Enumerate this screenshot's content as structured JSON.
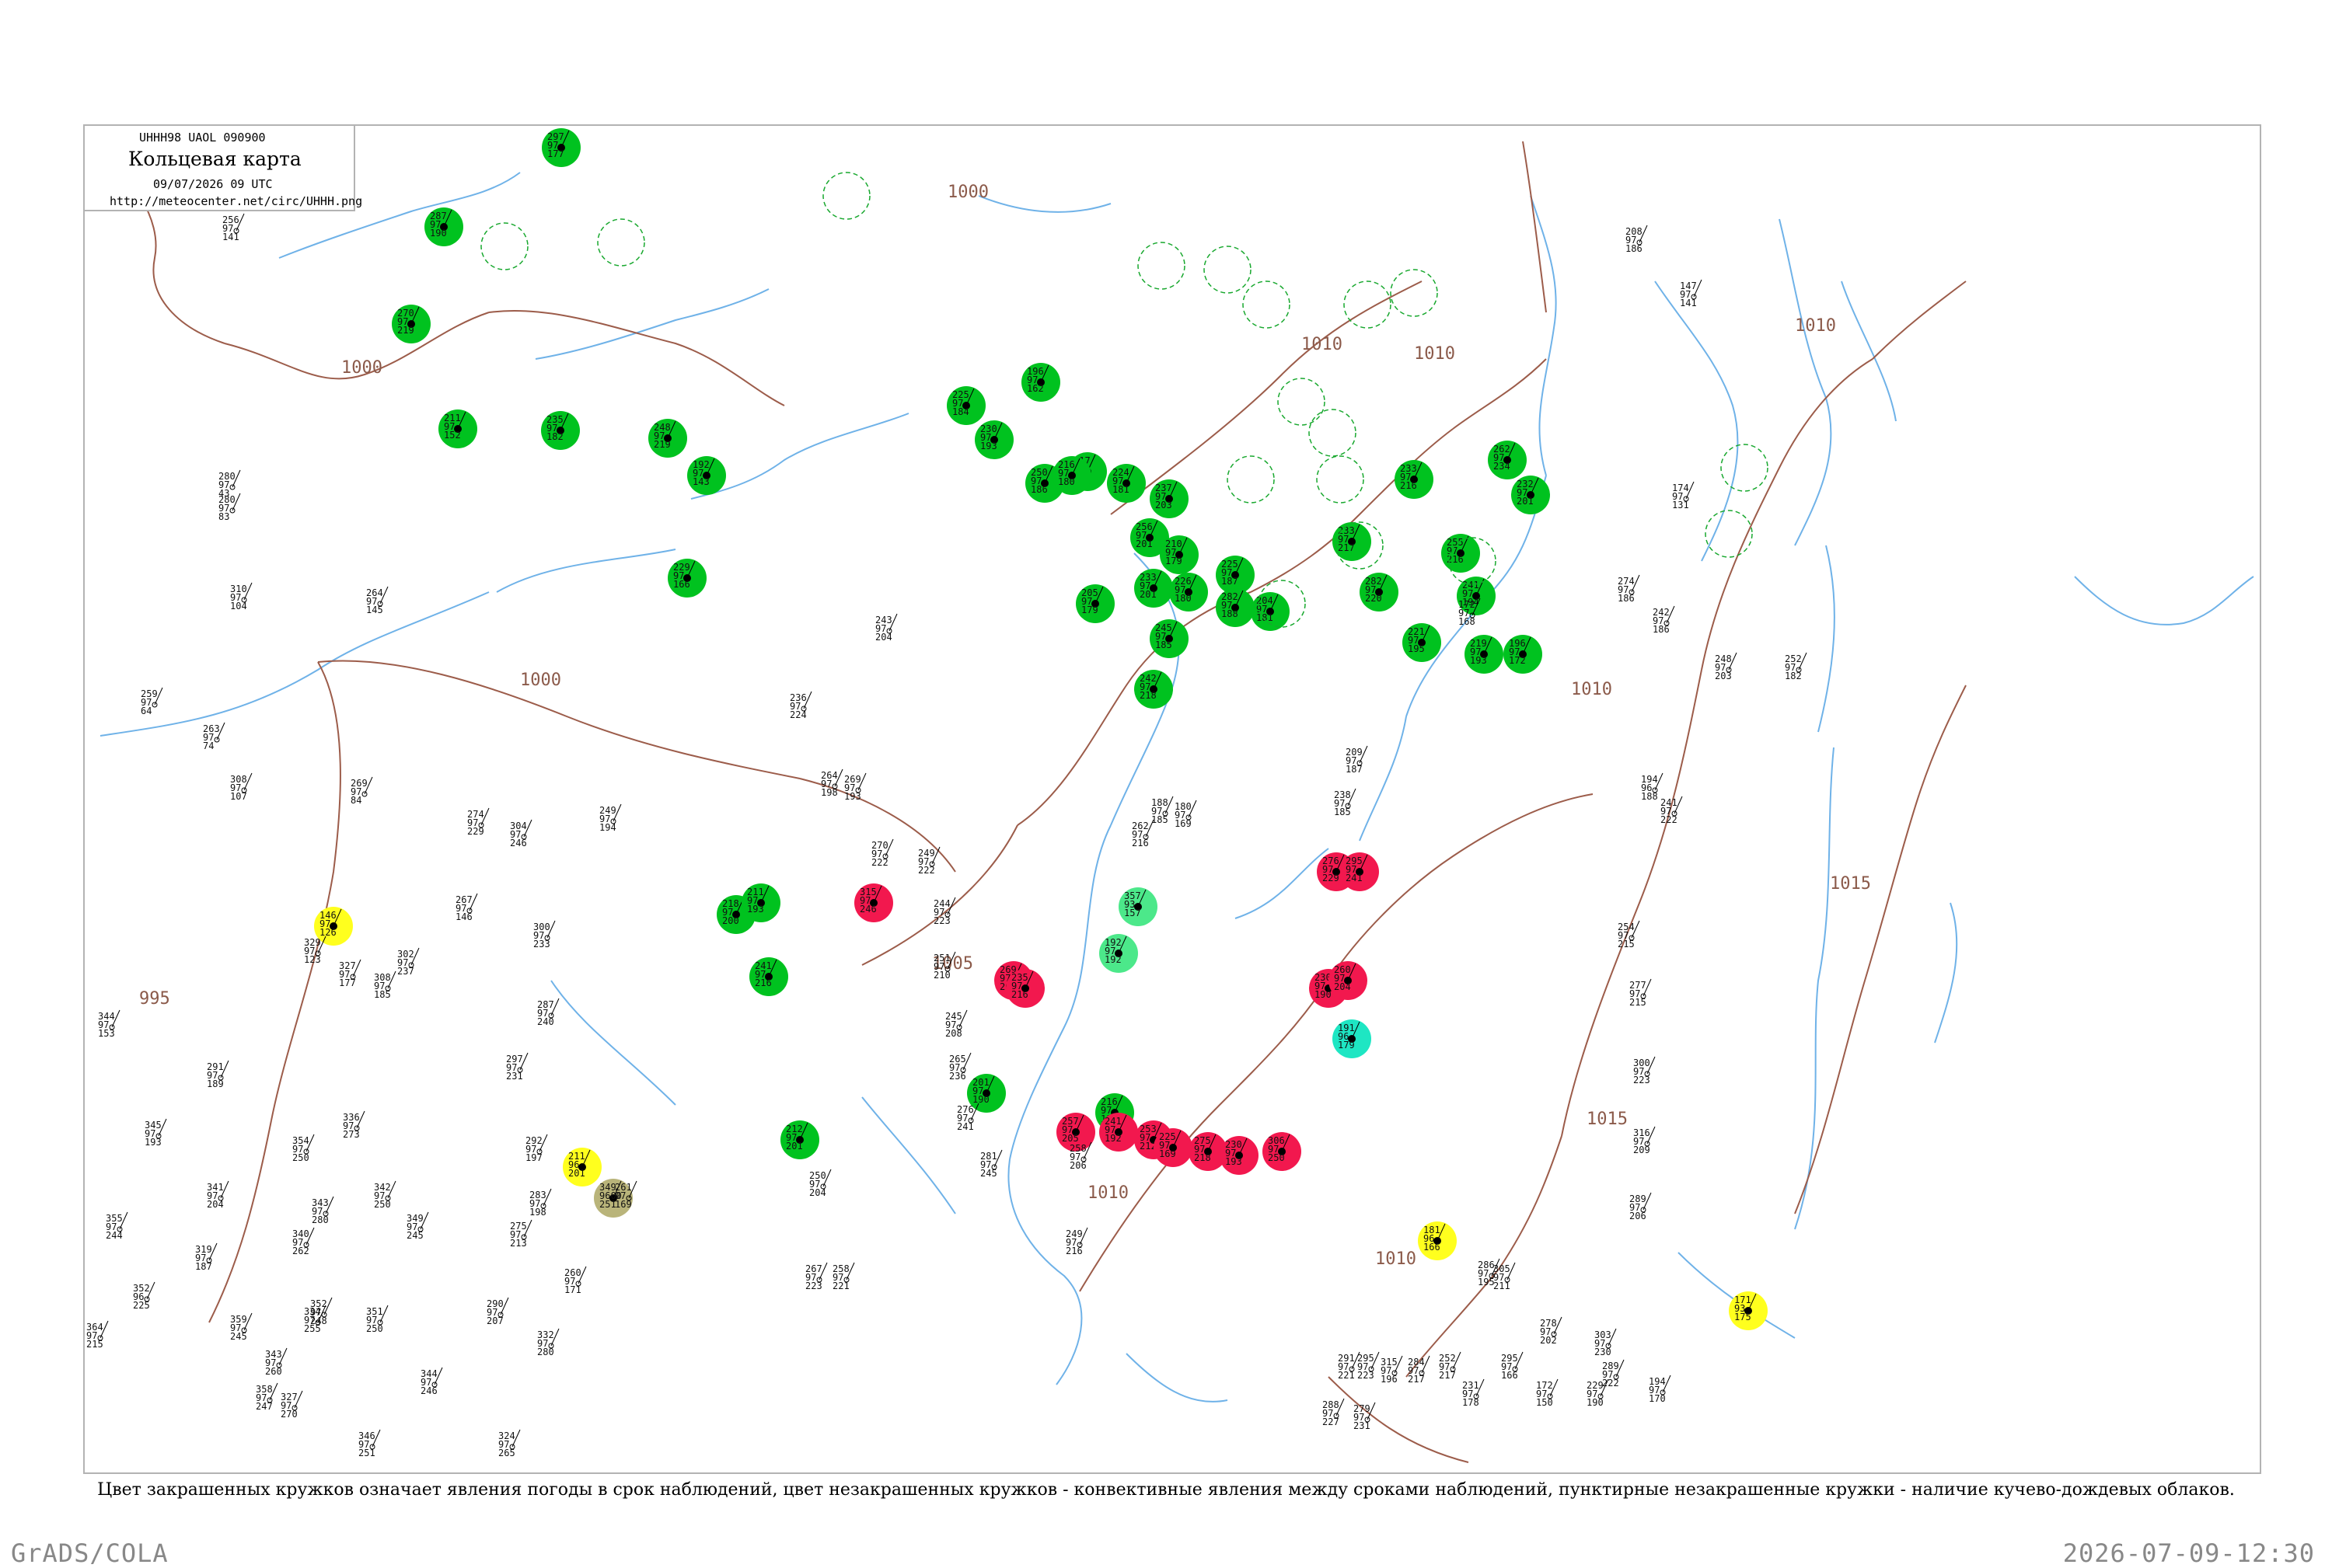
{
  "header": {
    "bulletin": "UHHH98 UAOL 090900",
    "title": "Кольцевая карта",
    "datetime": "09/07/2026 09 UTC",
    "url": "http://meteocenter.net/circ/UHHH.png"
  },
  "caption": "Цвет закрашенных кружков означает явления погоды в срок наблюдений, цвет незакрашенных кружков - конвективные явления между сроками наблюдений, пунктирные незакрашенные кружки - наличие кучево-дождевых облаков.",
  "footer": {
    "left": "GrADS/COLA",
    "right": "2026-07-09-12:30"
  },
  "colors": {
    "rain": "#00c21f",
    "thunderstorm": "#f2184e",
    "fog": "#ffff1e",
    "haze": "#1ee6c3",
    "showers": "#4ce88a",
    "dust": "#b9b47a",
    "isobar": "#9c5c4a",
    "water": "#6fb2e8",
    "cb_ring": "#18a82e"
  },
  "isobar_labels": [
    "1000",
    "1000",
    "1000",
    "995",
    "1005",
    "1010",
    "1010",
    "1010",
    "1015",
    "1015",
    "1010",
    "1010",
    "1010"
  ],
  "stations": [
    {
      "kind": "rain",
      "v": [
        "297",
        "97",
        "177"
      ]
    },
    {
      "kind": "rain",
      "v": [
        "287",
        "97",
        "190"
      ]
    },
    {
      "kind": "rain",
      "v": [
        "211",
        "97",
        "152"
      ]
    },
    {
      "kind": "rain",
      "v": [
        "235",
        "97",
        "182"
      ]
    },
    {
      "kind": "rain",
      "v": [
        "248",
        "97",
        "219"
      ]
    },
    {
      "kind": "rain",
      "v": [
        "225",
        "97",
        "184"
      ]
    },
    {
      "kind": "rain",
      "v": [
        "230",
        "97",
        "193"
      ]
    },
    {
      "kind": "rain",
      "v": [
        "192",
        "97",
        "143"
      ]
    },
    {
      "kind": "rain",
      "v": [
        "229",
        "97",
        "166"
      ]
    },
    {
      "kind": "rain",
      "v": [
        "270",
        "97",
        "219"
      ]
    },
    {
      "kind": "rain",
      "v": [
        "196",
        "97",
        "162"
      ]
    },
    {
      "kind": "rain",
      "v": [
        "217",
        "97",
        "177"
      ]
    },
    {
      "kind": "rain",
      "v": [
        "250",
        "97",
        "186"
      ]
    },
    {
      "kind": "rain",
      "v": [
        "224",
        "97",
        "181"
      ]
    },
    {
      "kind": "rain",
      "v": [
        "256",
        "97",
        "201"
      ]
    },
    {
      "kind": "rain",
      "v": [
        "237",
        "97",
        "203"
      ]
    },
    {
      "kind": "rain",
      "v": [
        "210",
        "97",
        "179"
      ]
    },
    {
      "kind": "rain",
      "v": [
        "216",
        "97",
        "180"
      ]
    },
    {
      "kind": "rain",
      "v": [
        "233",
        "97",
        "201"
      ]
    },
    {
      "kind": "rain",
      "v": [
        "226",
        "97",
        "180"
      ]
    },
    {
      "kind": "rain",
      "v": [
        "245",
        "97",
        "185"
      ]
    },
    {
      "kind": "rain",
      "v": [
        "225",
        "97",
        "187"
      ]
    },
    {
      "kind": "rain",
      "v": [
        "282",
        "97",
        "188"
      ]
    },
    {
      "kind": "rain",
      "v": [
        "204",
        "97",
        "181"
      ]
    },
    {
      "kind": "rain",
      "v": [
        "282",
        "97",
        "220"
      ]
    },
    {
      "kind": "rain",
      "v": [
        "233",
        "97",
        "217"
      ]
    },
    {
      "kind": "rain",
      "v": [
        "255",
        "97",
        "216"
      ]
    },
    {
      "kind": "rain",
      "v": [
        "241",
        "97",
        "194"
      ]
    },
    {
      "kind": "rain",
      "v": [
        "221",
        "97",
        "195"
      ]
    },
    {
      "kind": "rain",
      "v": [
        "219",
        "97",
        "193"
      ]
    },
    {
      "kind": "rain",
      "v": [
        "196",
        "97",
        "172"
      ]
    },
    {
      "kind": "rain",
      "v": [
        "262",
        "97",
        "234"
      ]
    },
    {
      "kind": "rain",
      "v": [
        "232",
        "97",
        "201"
      ]
    },
    {
      "kind": "rain",
      "v": [
        "233",
        "97",
        "216"
      ]
    },
    {
      "kind": "rain",
      "v": [
        "205",
        "97",
        "179"
      ]
    },
    {
      "kind": "rain",
      "v": [
        "242",
        "97",
        "218"
      ]
    },
    {
      "kind": "rain",
      "v": [
        "218",
        "97",
        "200"
      ]
    },
    {
      "kind": "rain",
      "v": [
        "211",
        "97",
        "193"
      ]
    },
    {
      "kind": "rain",
      "v": [
        "241",
        "97",
        "216"
      ]
    },
    {
      "kind": "rain",
      "v": [
        "212",
        "97",
        "201"
      ]
    },
    {
      "kind": "rain",
      "v": [
        "201",
        "97",
        "190"
      ]
    },
    {
      "kind": "rain",
      "v": [
        "216",
        "97",
        "197"
      ]
    },
    {
      "kind": "thunderstorm",
      "v": [
        "315",
        "97",
        "246"
      ]
    },
    {
      "kind": "thunderstorm",
      "v": [
        "269",
        "97",
        "206"
      ]
    },
    {
      "kind": "thunderstorm",
      "v": [
        "235",
        "97",
        "216"
      ]
    },
    {
      "kind": "thunderstorm",
      "v": [
        "257",
        "97",
        "205"
      ]
    },
    {
      "kind": "thunderstorm",
      "v": [
        "241",
        "97",
        "192"
      ]
    },
    {
      "kind": "thunderstorm",
      "v": [
        "253",
        "97",
        "212"
      ]
    },
    {
      "kind": "thunderstorm",
      "v": [
        "225",
        "97",
        "169"
      ]
    },
    {
      "kind": "thunderstorm",
      "v": [
        "275",
        "97",
        "218"
      ]
    },
    {
      "kind": "thunderstorm",
      "v": [
        "230",
        "97",
        "193"
      ]
    },
    {
      "kind": "thunderstorm",
      "v": [
        "306",
        "97",
        "250"
      ]
    },
    {
      "kind": "thunderstorm",
      "v": [
        "230",
        "97",
        "190"
      ]
    },
    {
      "kind": "thunderstorm",
      "v": [
        "260",
        "97",
        "204"
      ]
    },
    {
      "kind": "thunderstorm",
      "v": [
        "276",
        "97",
        "229"
      ]
    },
    {
      "kind": "thunderstorm",
      "v": [
        "295",
        "97",
        "241"
      ]
    },
    {
      "kind": "fog",
      "v": [
        "211",
        "96",
        "201"
      ]
    },
    {
      "kind": "fog",
      "v": [
        "146",
        "97",
        "126"
      ]
    },
    {
      "kind": "fog",
      "v": [
        "181",
        "96",
        "166"
      ]
    },
    {
      "kind": "fog",
      "v": [
        "171",
        "93",
        "175"
      ]
    },
    {
      "kind": "showers",
      "v": [
        "357",
        "93",
        "157"
      ]
    },
    {
      "kind": "showers",
      "v": [
        "192",
        "97",
        "192"
      ]
    },
    {
      "kind": "haze",
      "v": [
        "191",
        "96",
        "179"
      ]
    },
    {
      "kind": "dust",
      "v": [
        "349",
        "9600",
        "251"
      ]
    },
    {
      "kind": "plain",
      "v": [
        "310",
        "97",
        "104"
      ]
    },
    {
      "kind": "plain",
      "v": [
        "264",
        "97",
        "145"
      ]
    },
    {
      "kind": "plain",
      "v": [
        "280",
        "97",
        "43"
      ]
    },
    {
      "kind": "plain",
      "v": [
        "280",
        "97",
        "83"
      ]
    },
    {
      "kind": "plain",
      "v": [
        "256",
        "97",
        "141"
      ]
    },
    {
      "kind": "plain",
      "v": [
        "259",
        "97",
        "64"
      ]
    },
    {
      "kind": "plain",
      "v": [
        "263",
        "97",
        "74"
      ]
    },
    {
      "kind": "plain",
      "v": [
        "308",
        "97",
        "107"
      ]
    },
    {
      "kind": "plain",
      "v": [
        "269",
        "97",
        "84"
      ]
    },
    {
      "kind": "plain",
      "v": [
        "267",
        "97",
        "146"
      ]
    },
    {
      "kind": "plain",
      "v": [
        "329",
        "97",
        "123"
      ]
    },
    {
      "kind": "plain",
      "v": [
        "327",
        "97",
        "177"
      ]
    },
    {
      "kind": "plain",
      "v": [
        "308",
        "97",
        "185"
      ]
    },
    {
      "kind": "plain",
      "v": [
        "344",
        "97",
        "153"
      ]
    },
    {
      "kind": "plain",
      "v": [
        "291",
        "97",
        "189"
      ]
    },
    {
      "kind": "plain",
      "v": [
        "345",
        "97",
        "193"
      ]
    },
    {
      "kind": "plain",
      "v": [
        "341",
        "97",
        "204"
      ]
    },
    {
      "kind": "plain",
      "v": [
        "354",
        "97",
        "250"
      ]
    },
    {
      "kind": "plain",
      "v": [
        "343",
        "97",
        "280"
      ]
    },
    {
      "kind": "plain",
      "v": [
        "340",
        "97",
        "262"
      ]
    },
    {
      "kind": "plain",
      "v": [
        "336",
        "97",
        "273"
      ]
    },
    {
      "kind": "plain",
      "v": [
        "342",
        "97",
        "250"
      ]
    },
    {
      "kind": "plain",
      "v": [
        "349",
        "97",
        "245"
      ]
    },
    {
      "kind": "plain",
      "v": [
        "355",
        "97",
        "244"
      ]
    },
    {
      "kind": "plain",
      "v": [
        "319",
        "97",
        "187"
      ]
    },
    {
      "kind": "plain",
      "v": [
        "352",
        "96",
        "225"
      ]
    },
    {
      "kind": "plain",
      "v": [
        "359",
        "97",
        "245"
      ]
    },
    {
      "kind": "plain",
      "v": [
        "364",
        "97",
        "215"
      ]
    },
    {
      "kind": "plain",
      "v": [
        "343",
        "97",
        "260"
      ]
    },
    {
      "kind": "plain",
      "v": [
        "327",
        "97",
        "270"
      ]
    },
    {
      "kind": "plain",
      "v": [
        "358",
        "97",
        "247"
      ]
    },
    {
      "kind": "plain",
      "v": [
        "352",
        "97",
        "248"
      ]
    },
    {
      "kind": "plain",
      "v": [
        "334",
        "97",
        "255"
      ]
    },
    {
      "kind": "plain",
      "v": [
        "351",
        "97",
        "250"
      ]
    },
    {
      "kind": "plain",
      "v": [
        "344",
        "97",
        "246"
      ]
    },
    {
      "kind": "plain",
      "v": [
        "346",
        "97",
        "251"
      ]
    },
    {
      "kind": "plain",
      "v": [
        "332",
        "97",
        "275"
      ]
    },
    {
      "kind": "plain",
      "v": [
        "335",
        "97",
        "241"
      ]
    },
    {
      "kind": "plain",
      "v": [
        "324",
        "97",
        "265"
      ]
    },
    {
      "kind": "plain",
      "v": [
        "332",
        "97",
        "280"
      ]
    },
    {
      "kind": "plain",
      "v": [
        "290",
        "97",
        "207"
      ]
    },
    {
      "kind": "plain",
      "v": [
        "260",
        "97",
        "171"
      ]
    },
    {
      "kind": "plain",
      "v": [
        "249",
        "97",
        "194"
      ]
    },
    {
      "kind": "plain",
      "v": [
        "274",
        "97",
        "229"
      ]
    },
    {
      "kind": "plain",
      "v": [
        "304",
        "97",
        "246"
      ]
    },
    {
      "kind": "plain",
      "v": [
        "300",
        "97",
        "233"
      ]
    },
    {
      "kind": "plain",
      "v": [
        "302",
        "97",
        "237"
      ]
    },
    {
      "kind": "plain",
      "v": [
        "287",
        "97",
        "240"
      ]
    },
    {
      "kind": "plain",
      "v": [
        "297",
        "97",
        "231"
      ]
    },
    {
      "kind": "plain",
      "v": [
        "292",
        "97",
        "197"
      ]
    },
    {
      "kind": "plain",
      "v": [
        "283",
        "97",
        "198"
      ]
    },
    {
      "kind": "plain",
      "v": [
        "275",
        "97",
        "213"
      ]
    },
    {
      "kind": "plain",
      "v": [
        "261",
        "97",
        "169"
      ]
    },
    {
      "kind": "plain",
      "v": [
        "250",
        "97",
        "204"
      ]
    },
    {
      "kind": "plain",
      "v": [
        "267",
        "97",
        "223"
      ]
    },
    {
      "kind": "plain",
      "v": [
        "258",
        "97",
        "221"
      ]
    },
    {
      "kind": "plain",
      "v": [
        "243",
        "97",
        "204"
      ]
    },
    {
      "kind": "plain",
      "v": [
        "236",
        "97",
        "224"
      ]
    },
    {
      "kind": "plain",
      "v": [
        "264",
        "97",
        "198"
      ]
    },
    {
      "kind": "plain",
      "v": [
        "269",
        "97",
        "193"
      ]
    },
    {
      "kind": "plain",
      "v": [
        "270",
        "97",
        "222"
      ]
    },
    {
      "kind": "plain",
      "v": [
        "249",
        "97",
        "222"
      ]
    },
    {
      "kind": "plain",
      "v": [
        "244",
        "97",
        "223"
      ]
    },
    {
      "kind": "plain",
      "v": [
        "251",
        "97",
        "210"
      ]
    },
    {
      "kind": "plain",
      "v": [
        "245",
        "97",
        "208"
      ]
    },
    {
      "kind": "plain",
      "v": [
        "265",
        "97",
        "236"
      ]
    },
    {
      "kind": "plain",
      "v": [
        "276",
        "97",
        "241"
      ]
    },
    {
      "kind": "plain",
      "v": [
        "281",
        "97",
        "245"
      ]
    },
    {
      "kind": "plain",
      "v": [
        "249",
        "97",
        "216"
      ]
    },
    {
      "kind": "plain",
      "v": [
        "258",
        "97",
        "206"
      ]
    },
    {
      "kind": "plain",
      "v": [
        "262",
        "97",
        "216"
      ]
    },
    {
      "kind": "plain",
      "v": [
        "188",
        "97",
        "185"
      ]
    },
    {
      "kind": "plain",
      "v": [
        "180",
        "97",
        "169"
      ]
    },
    {
      "kind": "plain",
      "v": [
        "209",
        "97",
        "187"
      ]
    },
    {
      "kind": "plain",
      "v": [
        "238",
        "97",
        "185"
      ]
    },
    {
      "kind": "plain",
      "v": [
        "172",
        "97",
        "168"
      ]
    },
    {
      "kind": "plain",
      "v": [
        "194",
        "96",
        "188"
      ]
    },
    {
      "kind": "plain",
      "v": [
        "241",
        "97",
        "222"
      ]
    },
    {
      "kind": "plain",
      "v": [
        "254",
        "97",
        "215"
      ]
    },
    {
      "kind": "plain",
      "v": [
        "277",
        "97",
        "215"
      ]
    },
    {
      "kind": "plain",
      "v": [
        "300",
        "97",
        "223"
      ]
    },
    {
      "kind": "plain",
      "v": [
        "316",
        "97",
        "209"
      ]
    },
    {
      "kind": "plain",
      "v": [
        "289",
        "97",
        "206"
      ]
    },
    {
      "kind": "plain",
      "v": [
        "305",
        "97",
        "211"
      ]
    },
    {
      "kind": "plain",
      "v": [
        "286",
        "97",
        "195"
      ]
    },
    {
      "kind": "plain",
      "v": [
        "278",
        "97",
        "202"
      ]
    },
    {
      "kind": "plain",
      "v": [
        "303",
        "97",
        "230"
      ]
    },
    {
      "kind": "plain",
      "v": [
        "289",
        "97",
        "222"
      ]
    },
    {
      "kind": "plain",
      "v": [
        "284",
        "97",
        "217"
      ]
    },
    {
      "kind": "plain",
      "v": [
        "291",
        "97",
        "221"
      ]
    },
    {
      "kind": "plain",
      "v": [
        "288",
        "97",
        "227"
      ]
    },
    {
      "kind": "plain",
      "v": [
        "279",
        "97",
        "231"
      ]
    },
    {
      "kind": "plain",
      "v": [
        "295",
        "97",
        "223"
      ]
    },
    {
      "kind": "plain",
      "v": [
        "315",
        "97",
        "196"
      ]
    },
    {
      "kind": "plain",
      "v": [
        "252",
        "97",
        "217"
      ]
    },
    {
      "kind": "plain",
      "v": [
        "295",
        "97",
        "166"
      ]
    },
    {
      "kind": "plain",
      "v": [
        "231",
        "97",
        "178"
      ]
    },
    {
      "kind": "plain",
      "v": [
        "172",
        "97",
        "150"
      ]
    },
    {
      "kind": "plain",
      "v": [
        "229",
        "97",
        "190"
      ]
    },
    {
      "kind": "plain",
      "v": [
        "194",
        "97",
        "170"
      ]
    },
    {
      "kind": "plain",
      "v": [
        "208",
        "97",
        "186"
      ]
    },
    {
      "kind": "plain",
      "v": [
        "147",
        "97",
        "141"
      ]
    },
    {
      "kind": "plain",
      "v": [
        "174",
        "97",
        "131"
      ]
    },
    {
      "kind": "plain",
      "v": [
        "274",
        "97",
        "186"
      ]
    },
    {
      "kind": "plain",
      "v": [
        "242",
        "97",
        "186"
      ]
    },
    {
      "kind": "plain",
      "v": [
        "248",
        "97",
        "203"
      ]
    },
    {
      "kind": "plain",
      "v": [
        "252",
        "97",
        "182"
      ]
    }
  ]
}
